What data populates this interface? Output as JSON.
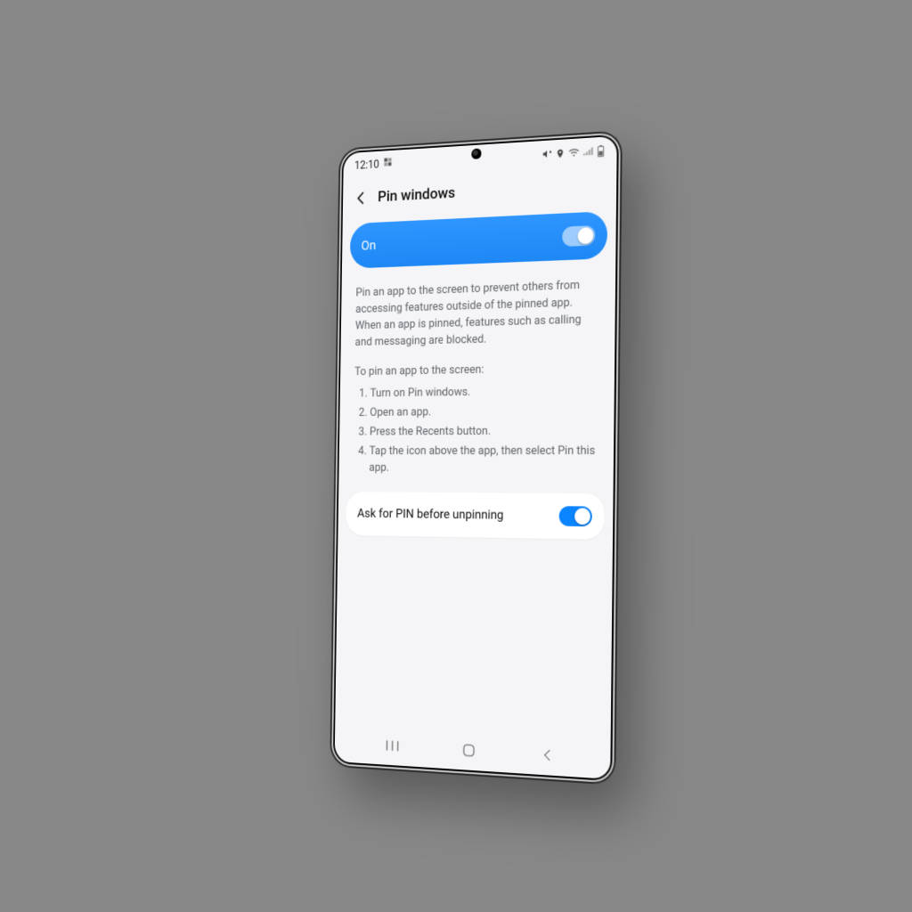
{
  "statusbar": {
    "time": "12:10"
  },
  "header": {
    "title": "Pin windows"
  },
  "mainToggle": {
    "label": "On",
    "state": "on"
  },
  "description": {
    "intro": "Pin an app to the screen to prevent others from accessing features outside of the pinned app. When an app is pinned, features such as calling and messaging are blocked.",
    "howto_title": "To pin an app to the screen:",
    "steps": [
      "Turn on Pin windows.",
      "Open an app.",
      "Press the Recents button.",
      "Tap the icon above the app, then select Pin this app."
    ]
  },
  "secondarySetting": {
    "label": "Ask for PIN before unpinning",
    "state": "on"
  },
  "colors": {
    "accent": "#1e90ff"
  }
}
